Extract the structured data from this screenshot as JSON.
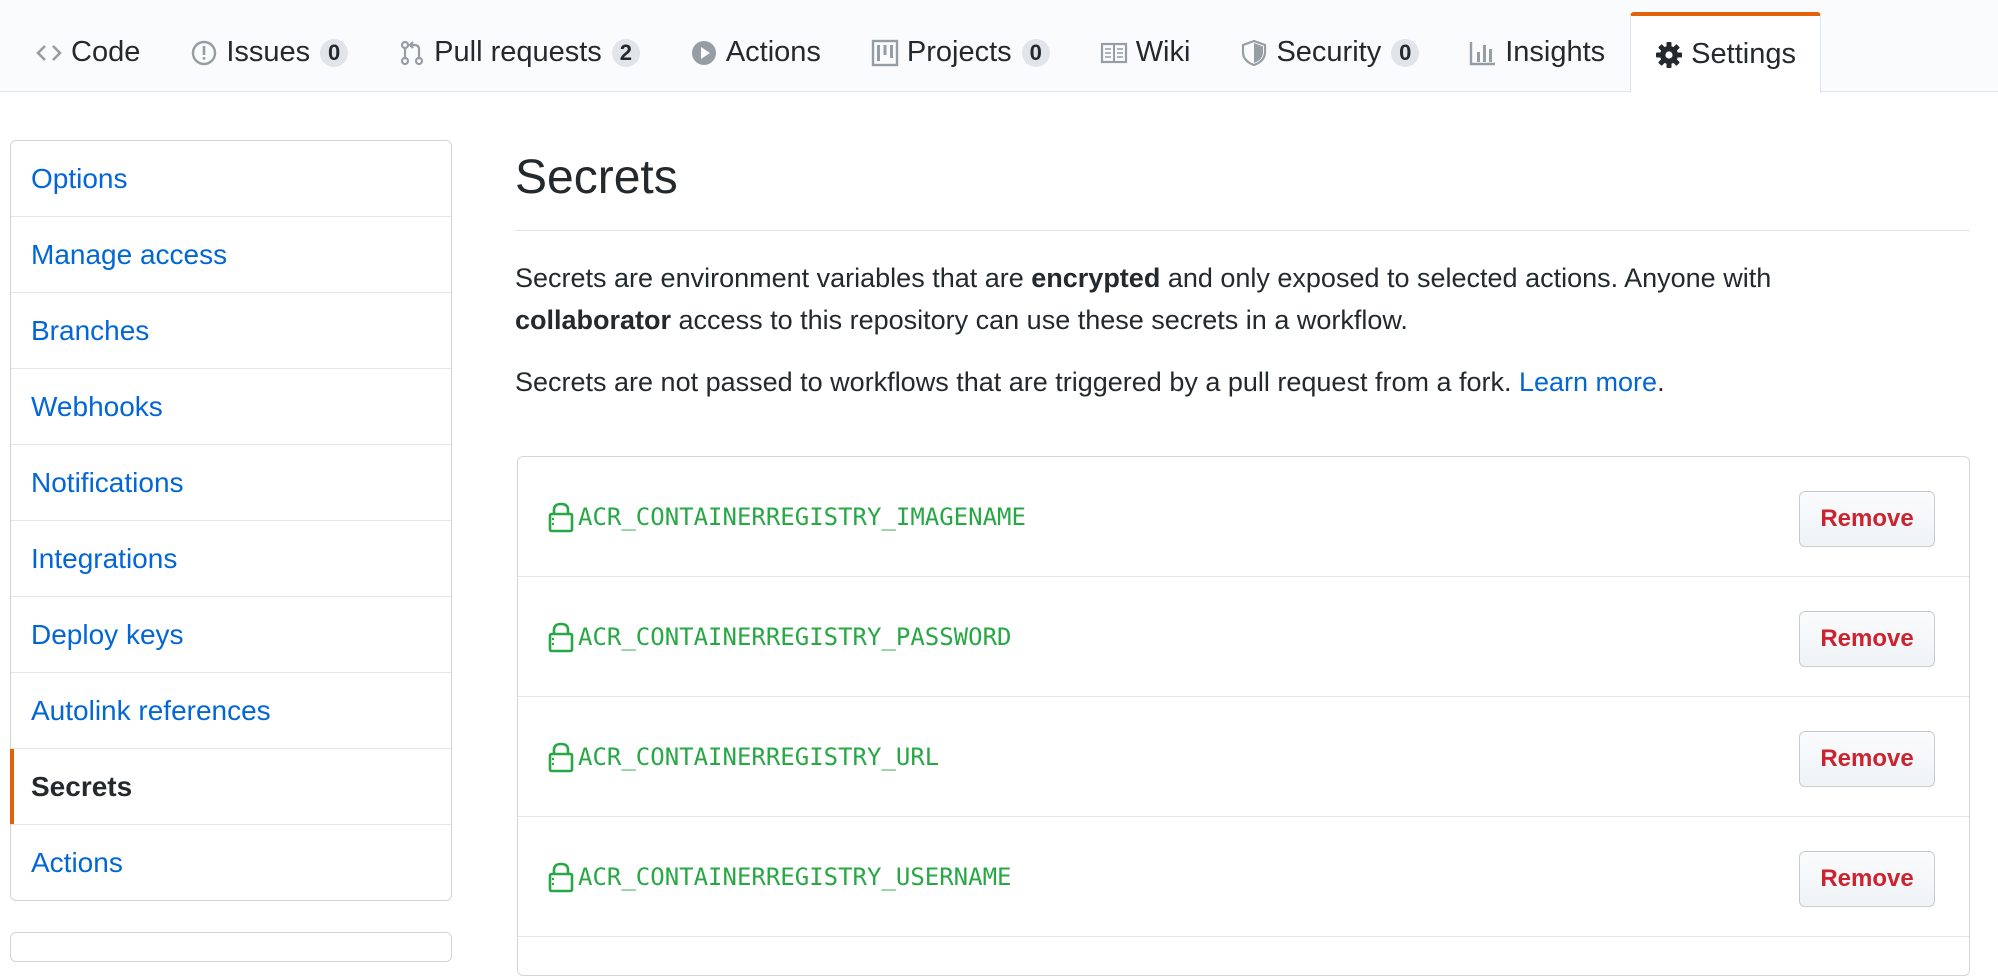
{
  "colors": {
    "accent_orange": "#e36209",
    "link_blue": "#0366d6",
    "secret_green": "#28a745",
    "danger_red": "#cb2431"
  },
  "nav": {
    "tabs": [
      {
        "label": "Code",
        "icon": "code-icon"
      },
      {
        "label": "Issues",
        "icon": "issue-icon",
        "count": "0"
      },
      {
        "label": "Pull requests",
        "icon": "pull-request-icon",
        "count": "2"
      },
      {
        "label": "Actions",
        "icon": "play-icon"
      },
      {
        "label": "Projects",
        "icon": "project-icon",
        "count": "0"
      },
      {
        "label": "Wiki",
        "icon": "book-icon"
      },
      {
        "label": "Security",
        "icon": "shield-icon",
        "count": "0"
      },
      {
        "label": "Insights",
        "icon": "graph-icon"
      },
      {
        "label": "Settings",
        "icon": "gear-icon",
        "selected": true
      }
    ]
  },
  "sidebar": {
    "items": [
      {
        "label": "Options"
      },
      {
        "label": "Manage access"
      },
      {
        "label": "Branches"
      },
      {
        "label": "Webhooks"
      },
      {
        "label": "Notifications"
      },
      {
        "label": "Integrations"
      },
      {
        "label": "Deploy keys"
      },
      {
        "label": "Autolink references"
      },
      {
        "label": "Secrets",
        "selected": true
      },
      {
        "label": "Actions"
      }
    ]
  },
  "main": {
    "title": "Secrets",
    "desc": {
      "part1": "Secrets are environment variables that are ",
      "bold1": "encrypted",
      "part2": " and only exposed to selected actions. Anyone with ",
      "bold2": "collaborator",
      "part3": " access to this repository can use these secrets in a workflow."
    },
    "note": {
      "text": "Secrets are not passed to workflows that are triggered by a pull request from a fork. ",
      "link": "Learn more",
      "end": "."
    },
    "secrets": [
      {
        "name": "ACR_CONTAINERREGISTRY_IMAGENAME",
        "action": "Remove"
      },
      {
        "name": "ACR_CONTAINERREGISTRY_PASSWORD",
        "action": "Remove"
      },
      {
        "name": "ACR_CONTAINERREGISTRY_URL",
        "action": "Remove"
      },
      {
        "name": "ACR_CONTAINERREGISTRY_USERNAME",
        "action": "Remove"
      }
    ]
  }
}
